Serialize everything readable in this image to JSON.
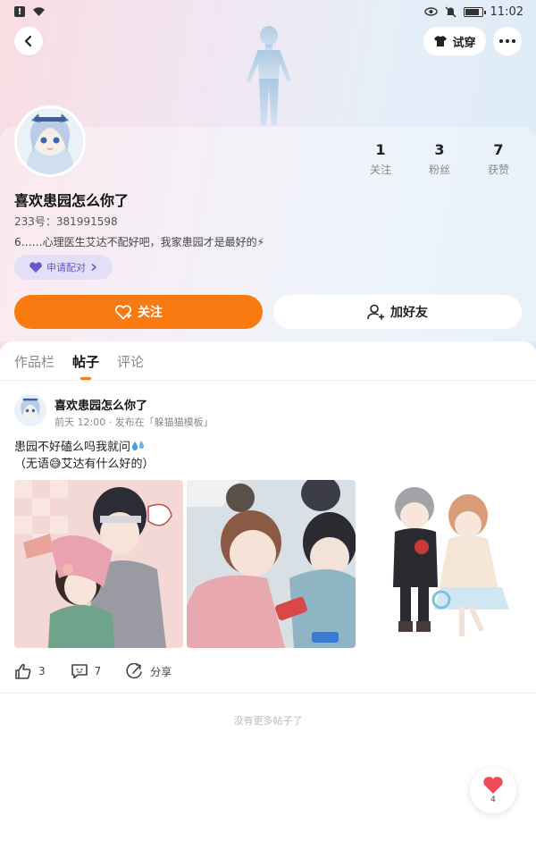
{
  "status_bar": {
    "time": "11:02"
  },
  "nav": {
    "try_label": "试穿"
  },
  "profile": {
    "stats": [
      {
        "value": "1",
        "label": "关注"
      },
      {
        "value": "3",
        "label": "粉丝"
      },
      {
        "value": "7",
        "label": "获赞"
      }
    ],
    "username": "喜欢患园怎么你了",
    "id_text": "233号：381991598",
    "bio": "6……心理医生艾达不配好吧，我家患园才是最好的⚡",
    "pair_label": "申请配对",
    "follow_label": "关注",
    "add_friend_label": "加好友"
  },
  "tabs": [
    {
      "label": "作品栏",
      "active": false
    },
    {
      "label": "帖子",
      "active": true
    },
    {
      "label": "评论",
      "active": false
    }
  ],
  "post": {
    "author": "喜欢患园怎么你了",
    "meta": "前天 12:00 · 发布在「躲猫猫模板」",
    "text_line1": "患园不好磕么吗我就问",
    "text_line2": "（无语😅艾达有什么好的）",
    "likes": "3",
    "comments": "7",
    "share_label": "分享"
  },
  "footer_text": "没有更多帖子了",
  "like_fab_count": "4",
  "colors": {
    "accent": "#fa7a12",
    "pair_bg": "#e3dff7",
    "pair_text": "#6a55c9",
    "like": "#f04a5a"
  }
}
